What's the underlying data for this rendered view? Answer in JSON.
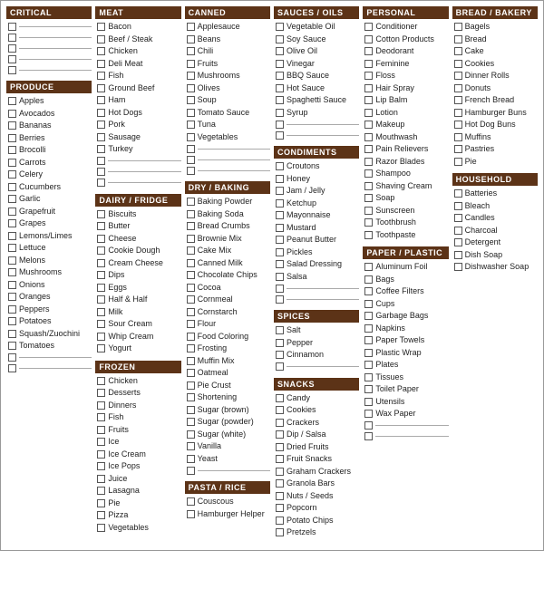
{
  "columns": [
    {
      "sections": [
        {
          "id": "critical",
          "header": "CRITICAL",
          "items": [],
          "blanks": 5
        },
        {
          "id": "produce",
          "header": "PRODUCE",
          "items": [
            "Apples",
            "Avocados",
            "Bananas",
            "Berries",
            "Brocolli",
            "Carrots",
            "Celery",
            "Cucumbers",
            "Garlic",
            "Grapefruit",
            "Grapes",
            "Lemons/Limes",
            "Lettuce",
            "Melons",
            "Mushrooms",
            "Onions",
            "Oranges",
            "Peppers",
            "Potatoes",
            "Squash/Zuochini",
            "Tomatoes"
          ],
          "blanks": 2
        }
      ]
    },
    {
      "sections": [
        {
          "id": "meat",
          "header": "MEAT",
          "items": [
            "Bacon",
            "Beef / Steak",
            "Chicken",
            "Deli Meat",
            "Fish",
            "Ground Beef",
            "Ham",
            "Hot Dogs",
            "Pork",
            "Sausage",
            "Turkey"
          ],
          "blanks": 3
        },
        {
          "id": "dairy",
          "header": "DAIRY / FRIDGE",
          "items": [
            "Biscuits",
            "Butter",
            "Cheese",
            "Cookie Dough",
            "Cream Cheese",
            "Dips",
            "Eggs",
            "Half & Half",
            "Milk",
            "Sour Cream",
            "Whip Cream",
            "Yogurt"
          ],
          "blanks": 0
        },
        {
          "id": "frozen",
          "header": "FROZEN",
          "items": [
            "Chicken",
            "Desserts",
            "Dinners",
            "Fish",
            "Fruits",
            "Ice",
            "Ice Cream",
            "Ice Pops",
            "Juice",
            "Lasagna",
            "Pie",
            "Pizza",
            "Vegetables"
          ],
          "blanks": 0
        }
      ]
    },
    {
      "sections": [
        {
          "id": "canned",
          "header": "CANNED",
          "items": [
            "Applesauce",
            "Beans",
            "Chili",
            "Fruits",
            "Mushrooms",
            "Olives",
            "Soup",
            "Tomato Sauce",
            "Tuna",
            "Vegetables"
          ],
          "blanks": 3
        },
        {
          "id": "drybaking",
          "header": "DRY / BAKING",
          "items": [
            "Baking Powder",
            "Baking Soda",
            "Bread Crumbs",
            "Brownie Mix",
            "Cake Mix",
            "Canned Milk",
            "Chocolate Chips",
            "Cocoa",
            "Cornmeal",
            "Cornstarch",
            "Flour",
            "Food Coloring",
            "Frosting",
            "Muffin Mix",
            "Oatmeal",
            "Pie Crust",
            "Shortening",
            "Sugar (brown)",
            "Sugar (powder)",
            "Sugar (white)",
            "Vanilla",
            "Yeast"
          ],
          "blanks": 1
        },
        {
          "id": "pastarice",
          "header": "PASTA / RICE",
          "items": [
            "Couscous",
            "Hamburger Helper"
          ],
          "blanks": 0
        }
      ]
    },
    {
      "sections": [
        {
          "id": "sauces",
          "header": "SAUCES / OILS",
          "items": [
            "Vegetable Oil",
            "Soy Sauce",
            "Olive Oil",
            "Vinegar",
            "BBQ Sauce",
            "Hot Sauce",
            "Spaghetti Sauce",
            "Syrup"
          ],
          "blanks": 2
        },
        {
          "id": "condiments",
          "header": "CONDIMENTS",
          "items": [
            "Croutons",
            "Honey",
            "Jam / Jelly",
            "Ketchup",
            "Mayonnaise",
            "Mustard",
            "Peanut Butter",
            "Pickles",
            "Salad Dressing",
            "Salsa"
          ],
          "blanks": 2
        },
        {
          "id": "spices",
          "header": "SPICES",
          "items": [
            "Salt",
            "Pepper",
            "Cinnamon"
          ],
          "blanks": 1
        },
        {
          "id": "snacks",
          "header": "SNACKS",
          "items": [
            "Candy",
            "Cookies",
            "Crackers",
            "Dip / Salsa",
            "Dried Fruits",
            "Fruit Snacks",
            "Graham Crackers",
            "Granola Bars",
            "Nuts / Seeds",
            "Popcorn",
            "Potato Chips",
            "Pretzels"
          ],
          "blanks": 0
        }
      ]
    },
    {
      "sections": [
        {
          "id": "personal",
          "header": "PERSONAL",
          "items": [
            "Conditioner",
            "Cotton Products",
            "Deodorant",
            "Feminine",
            "Floss",
            "Hair Spray",
            "Lip Balm",
            "Lotion",
            "Makeup",
            "Mouthwash",
            "Pain Relievers",
            "Razor Blades",
            "Shampoo",
            "Shaving Cream",
            "Soap",
            "Sunscreen",
            "Toothbrush",
            "Toothpaste"
          ],
          "blanks": 0
        },
        {
          "id": "paperplastic",
          "header": "PAPER / PLASTIC",
          "items": [
            "Aluminum Foil",
            "Bags",
            "Coffee Filters",
            "Cups",
            "Garbage Bags",
            "Napkins",
            "Paper Towels",
            "Plastic Wrap",
            "Plates",
            "Tissues",
            "Toilet Paper",
            "Utensils",
            "Wax Paper"
          ],
          "blanks": 2
        }
      ]
    },
    {
      "sections": [
        {
          "id": "breadbakery",
          "header": "BREAD / BAKERY",
          "items": [
            "Bagels",
            "Bread",
            "Cake",
            "Cookies",
            "Dinner Rolls",
            "Donuts",
            "French Bread",
            "Hamburger Buns",
            "Hot Dog Buns",
            "Muffins",
            "Pastries",
            "Pie"
          ],
          "blanks": 0
        },
        {
          "id": "household",
          "header": "HOUSEHOLD",
          "items": [
            "Batteries",
            "Bleach",
            "Candles",
            "Charcoal",
            "Detergent",
            "Dish Soap",
            "Dishwasher Soap"
          ],
          "blanks": 0
        }
      ]
    }
  ]
}
